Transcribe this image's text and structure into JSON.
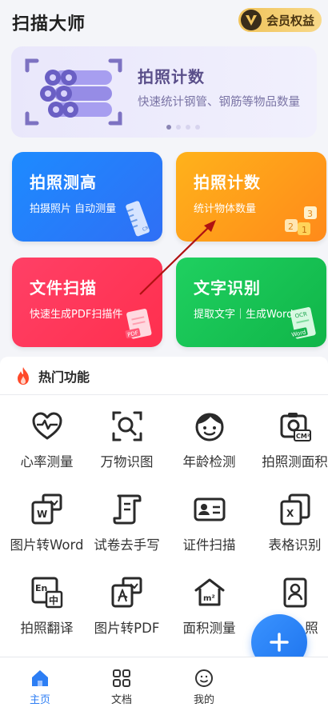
{
  "header": {
    "title": "扫描大师",
    "vip_badge": "V",
    "vip_label": "会员权益"
  },
  "banner": {
    "title": "拍照计数",
    "subtitle": "快速统计钢管、钢筋等物品数量",
    "dots": 4,
    "active_dot": 0
  },
  "cards": [
    {
      "title": "拍照测高",
      "subtitle": "拍摄照片 自动测量"
    },
    {
      "title": "拍照计数",
      "subtitle": "统计物体数量"
    },
    {
      "title": "文件扫描",
      "subtitle": "快速生成PDF扫描件"
    },
    {
      "title": "文字识别",
      "subtitle": "提取文字｜生成Word"
    }
  ],
  "hot": {
    "title": "热门功能",
    "items": [
      {
        "label": "心率测量",
        "icon": "heart-pulse-icon"
      },
      {
        "label": "万物识图",
        "icon": "image-search-icon"
      },
      {
        "label": "年龄检测",
        "icon": "face-icon"
      },
      {
        "label": "拍照测面积",
        "icon": "camera-area-icon"
      },
      {
        "label": "图片转Word",
        "icon": "word-image-icon"
      },
      {
        "label": "试卷去手写",
        "icon": "scroll-icon"
      },
      {
        "label": "证件扫描",
        "icon": "id-card-icon"
      },
      {
        "label": "表格识别",
        "icon": "excel-icon"
      },
      {
        "label": "拍照翻译",
        "icon": "translate-icon"
      },
      {
        "label": "图片转PDF",
        "icon": "pdf-image-icon"
      },
      {
        "label": "面积测量",
        "icon": "house-area-icon"
      },
      {
        "label": "照",
        "icon": "id-photo-icon"
      }
    ]
  },
  "card_illustrations": {
    "ruler_text": "CM",
    "numbers": [
      "2",
      "3",
      "1"
    ],
    "pdf_tag": "PDF",
    "ocr_tag": "OCR",
    "word_tag": "Word"
  },
  "icon_text": {
    "cm2": "CM²",
    "w": "W",
    "x": "X",
    "en": "En",
    "zh": "中",
    "m2": "m²"
  },
  "nav": {
    "items": [
      {
        "label": "主页",
        "active": true
      },
      {
        "label": "文档",
        "active": false
      },
      {
        "label": "我的",
        "active": false
      }
    ]
  },
  "colors": {
    "accent": "#2d7ef4",
    "arrow": "#b01212"
  }
}
